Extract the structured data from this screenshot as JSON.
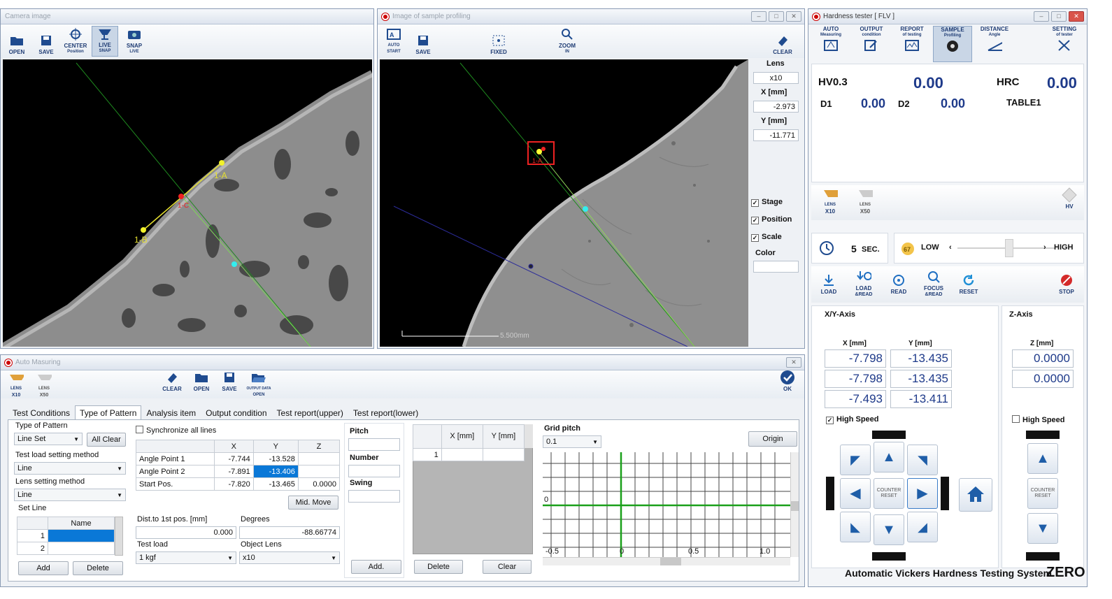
{
  "camera": {
    "title": "Camera image",
    "tools": [
      "OPEN",
      "SAVE",
      "CENTER",
      "LIVE",
      "SNAP"
    ],
    "tools_sub": [
      "",
      "",
      "Position",
      "SNAP",
      "LIVE"
    ],
    "labels": {
      "a": "1-A",
      "b": "1-B",
      "c": "1-C"
    }
  },
  "profiling": {
    "title": "Image of sample profiling",
    "tools": [
      "AUTO",
      "SAVE",
      "FIXED",
      "ZOOM",
      "CLEAR"
    ],
    "tools_sub": [
      "START",
      "",
      "",
      "IN",
      ""
    ],
    "lens_label": "Lens",
    "lens_value": "x10",
    "x_label": "X [mm]",
    "x_value": "-2.973",
    "y_label": "Y [mm]",
    "y_value": "-11.771",
    "stage": "Stage",
    "position": "Position",
    "scale": "Scale",
    "color": "Color",
    "scale_text": "5.500mm",
    "marker_label": "1-A"
  },
  "tester": {
    "title": "Hardness tester [ FLV ]",
    "tabs": [
      {
        "t": "AUTO",
        "s": "Measuring"
      },
      {
        "t": "OUTPUT",
        "s": "condition"
      },
      {
        "t": "REPORT",
        "s": "of testing"
      },
      {
        "t": "SAMPLE",
        "s": "Profiling"
      },
      {
        "t": "DISTANCE",
        "s": "Angle"
      },
      {
        "t": "SETTING",
        "s": "of tester"
      }
    ],
    "hv_label": "HV0.3",
    "hv_value": "0.00",
    "hrc_label": "HRC",
    "hrc_value": "0.00",
    "d1_label": "D1",
    "d1_value": "0.00",
    "d2_label": "D2",
    "d2_value": "0.00",
    "table": "TABLE1",
    "lens1": "LENS",
    "lens1b": "X10",
    "lens2": "LENS",
    "lens2b": "X50",
    "hv_btn": "HV",
    "time_value": "5",
    "time_unit": "SEC.",
    "speed_num": "67",
    "speed_low": "LOW",
    "speed_high": "HIGH",
    "actions": [
      {
        "t": "LOAD",
        "s": ""
      },
      {
        "t": "LOAD",
        "s": "&READ"
      },
      {
        "t": "READ",
        "s": ""
      },
      {
        "t": "FOCUS",
        "s": "&READ"
      },
      {
        "t": "RESET",
        "s": ""
      },
      {
        "t": "STOP",
        "s": ""
      }
    ],
    "xy_axis": "X/Y-Axis",
    "z_axis": "Z-Axis",
    "x_head": "X [mm]",
    "y_head": "Y [mm]",
    "z_head": "Z [mm]",
    "rows": [
      {
        "x": "-7.798",
        "y": "-13.435",
        "z": "0.0000"
      },
      {
        "x": "-7.798",
        "y": "-13.435",
        "z": "0.0000"
      },
      {
        "x": "-7.493",
        "y": "-13.411"
      }
    ],
    "high_speed": "High Speed",
    "counter": "COUNTER",
    "reset": "RESET",
    "footer": "Automatic Vickers Hardness Testing System",
    "footer_brand": "ZERO"
  },
  "auto": {
    "title": "Auto Masuring",
    "lens1": "LENS",
    "lens1b": "X10",
    "lens2": "LENS",
    "lens2b": "X50",
    "tools": [
      "CLEAR",
      "OPEN",
      "SAVE",
      "OUTPUT DATA"
    ],
    "tools_sub": [
      "",
      "",
      "",
      "OPEN"
    ],
    "ok": "OK",
    "tabs": [
      "Test Conditions",
      "Type of Pattern",
      "Analysis item",
      "Output condition",
      "Test report(upper)",
      "Test report(lower)"
    ],
    "type_of_pattern": "Type of Pattern",
    "pattern_value": "Line Set",
    "all_clear": "All Clear",
    "load_method": "Test load setting method",
    "load_method_value": "Line",
    "lens_method": "Lens setting method",
    "lens_method_value": "Line",
    "set_line": "Set Line",
    "name_head": "Name",
    "set_rows": [
      "1",
      "2"
    ],
    "add": "Add",
    "delete": "Delete",
    "sync": "Synchronize all lines",
    "cols": [
      "X",
      "Y",
      "Z"
    ],
    "points": [
      {
        "n": "Angle Point 1",
        "x": "-7.744",
        "y": "-13.528",
        "z": ""
      },
      {
        "n": "Angle Point 2",
        "x": "-7.891",
        "y": "-13.406",
        "z": ""
      },
      {
        "n": "Start Pos.",
        "x": "-7.820",
        "y": "-13.465",
        "z": "0.0000"
      }
    ],
    "mid_move": "Mid. Move",
    "dist_label": "Dist.to 1st pos. [mm]",
    "dist_value": "0.000",
    "deg_label": "Degrees",
    "deg_value": "-88.66774",
    "test_load": "Test load",
    "test_load_value": "1 kgf",
    "obj_lens": "Object Lens",
    "obj_lens_value": "x10",
    "pitch": "Pitch",
    "number": "Number",
    "swing": "Swing",
    "add2": "Add.",
    "list_x": "X [mm]",
    "list_y": "Y [mm]",
    "list_row": "1",
    "delete2": "Delete",
    "clear2": "Clear",
    "grid_pitch": "Grid pitch",
    "grid_value": "0.1",
    "origin": "Origin",
    "axis_ticks": [
      "-0.5",
      "0",
      "0.5",
      "1.0"
    ],
    "y_tick": "0"
  }
}
